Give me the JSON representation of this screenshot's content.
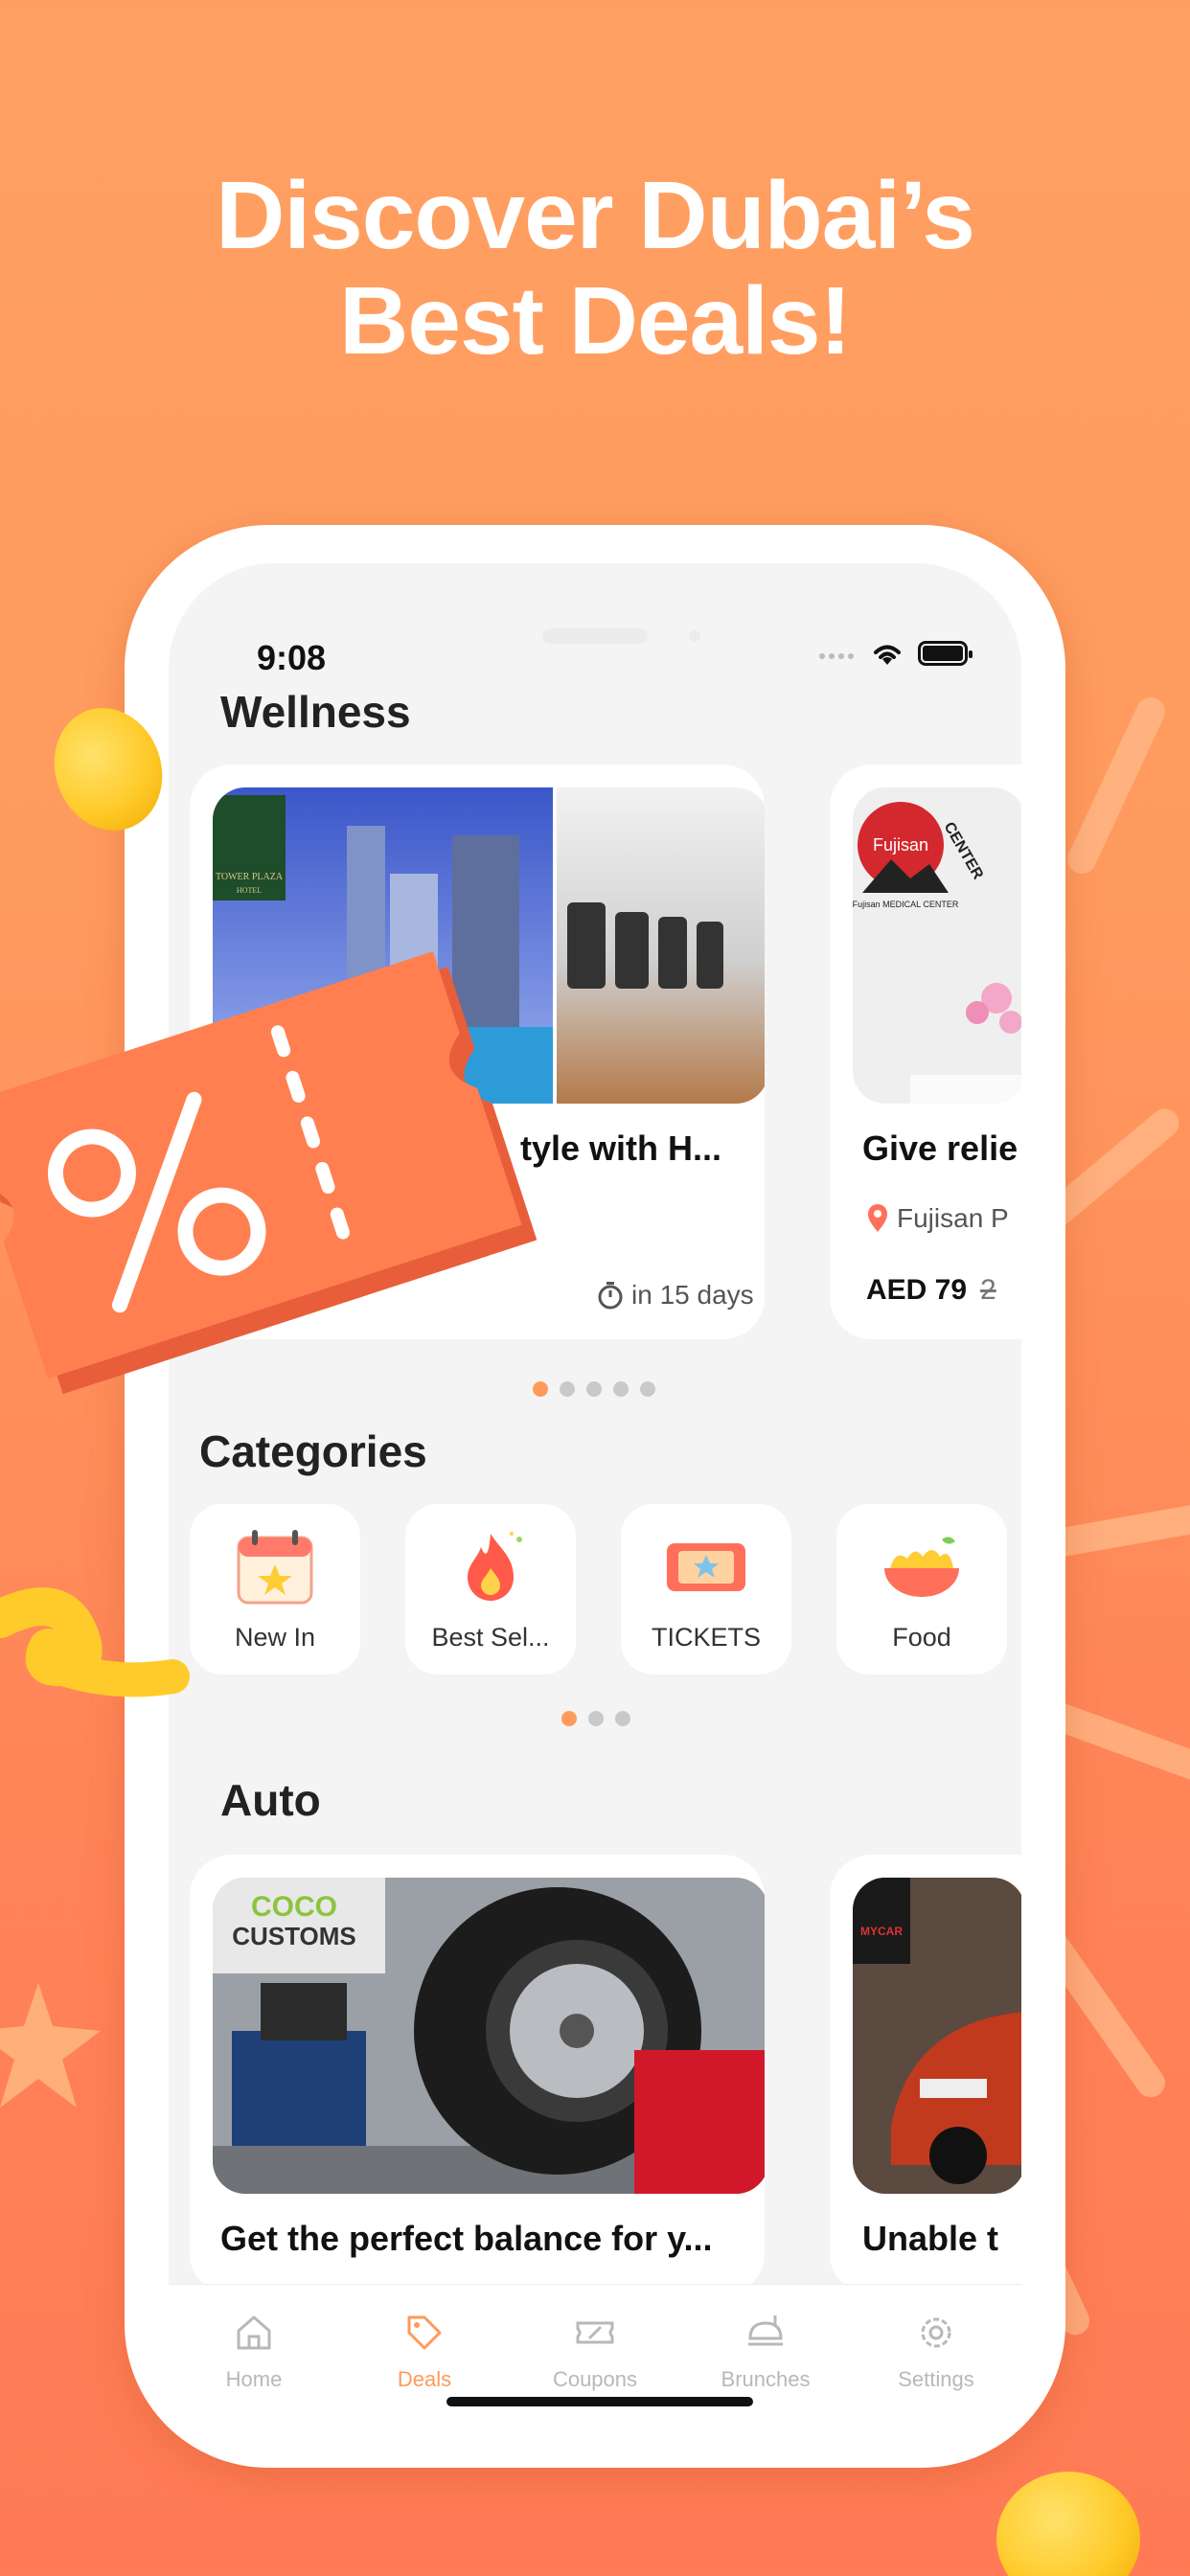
{
  "headline": {
    "line1": "Discover Dubai’s",
    "line2": "Best Deals!"
  },
  "status_bar": {
    "time": "9:08"
  },
  "sections": {
    "wellness": {
      "title": "Wellness",
      "cards": [
        {
          "title": "tyle with H...",
          "expiry": "in 15 days"
        },
        {
          "title": "Give relie",
          "location": "Fujisan P",
          "price": "AED 79",
          "old_price": "2"
        }
      ],
      "image_text": {
        "hotel": "TOWER PLAZA",
        "hotel_sub": "HOTEL",
        "clinic": "Fujisan",
        "clinic_ring": "CENTER",
        "clinic_sub": "Fujisan MEDICAL CENTER"
      }
    },
    "categories": {
      "title": "Categories",
      "items": [
        {
          "label": "New In",
          "icon": "calendar-icon"
        },
        {
          "label": "Best Sel...",
          "icon": "fire-icon"
        },
        {
          "label": "TICKETS",
          "icon": "ticket-icon"
        },
        {
          "label": "Food",
          "icon": "noodles-icon"
        }
      ]
    },
    "auto": {
      "title": "Auto",
      "cards": [
        {
          "title": "Get the perfect balance for y..."
        },
        {
          "title": "Unable t"
        }
      ],
      "image_text": {
        "shop": "CUSTOMS",
        "shop_top": "COCO",
        "car": "MYCAR"
      }
    }
  },
  "tabs": [
    {
      "label": "Home",
      "icon": "home-icon",
      "active": false
    },
    {
      "label": "Deals",
      "icon": "tag-icon",
      "active": true
    },
    {
      "label": "Coupons",
      "icon": "coupon-icon",
      "active": false
    },
    {
      "label": "Brunches",
      "icon": "brunch-icon",
      "active": false
    },
    {
      "label": "Settings",
      "icon": "gear-icon",
      "active": false
    }
  ],
  "colors": {
    "accent": "#ff9a5a",
    "background": "#ff9a5e",
    "coupon": "#ff7f50"
  }
}
